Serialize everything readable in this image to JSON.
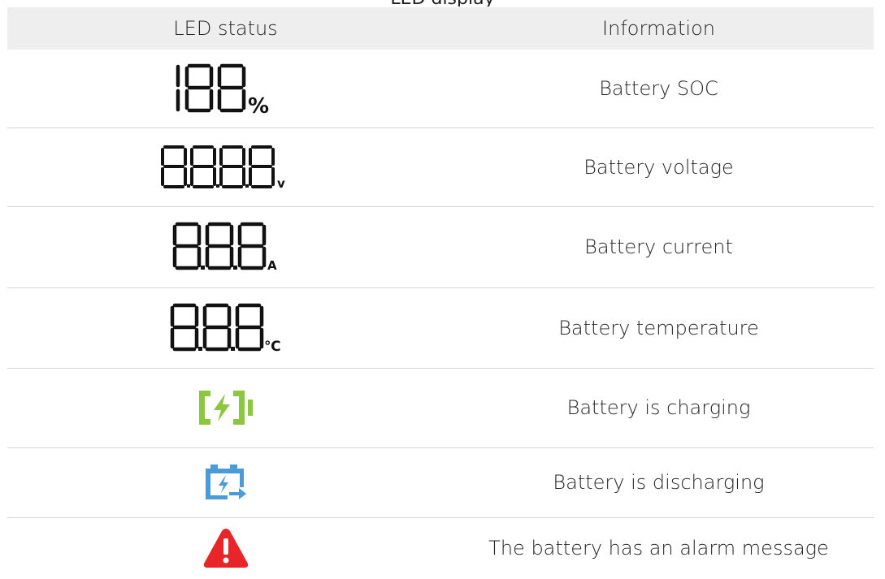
{
  "top_text": "LED display",
  "header": {
    "led_status": "LED status",
    "information": "Information"
  },
  "rows": [
    {
      "led": {
        "type": "segment",
        "display": "188",
        "unit": "%"
      },
      "info": "Battery SOC"
    },
    {
      "led": {
        "type": "segment",
        "display": "8.8.8.8",
        "unit": "v"
      },
      "info": "Battery voltage"
    },
    {
      "led": {
        "type": "segment",
        "display": "8.8.8",
        "unit": "A"
      },
      "info": "Battery current"
    },
    {
      "led": {
        "type": "segment",
        "display": "8.8.8",
        "unit": "℃"
      },
      "info": "Battery temperature"
    },
    {
      "led": {
        "type": "icon",
        "icon": "battery-charging-icon",
        "color": "#8dc63f"
      },
      "info": "Battery is charging"
    },
    {
      "led": {
        "type": "icon",
        "icon": "battery-discharging-icon",
        "color": "#4a9bd6"
      },
      "info": "Battery is discharging"
    },
    {
      "led": {
        "type": "icon",
        "icon": "alarm-warning-icon",
        "color": "#e8262a"
      },
      "info": "The battery has an alarm message"
    }
  ]
}
